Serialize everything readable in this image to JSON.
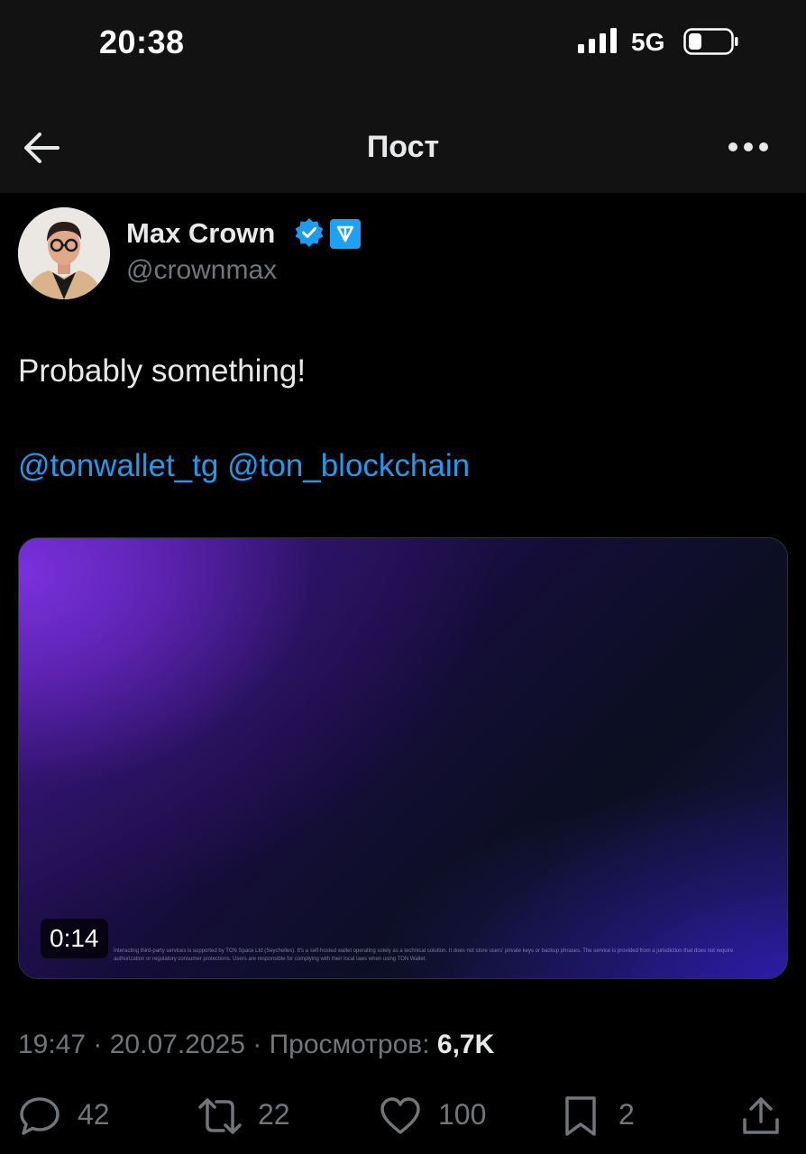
{
  "status_bar": {
    "time": "20:38",
    "network": "5G",
    "icons": [
      "signal-bars-icon",
      "battery-icon"
    ]
  },
  "nav": {
    "title": "Пост",
    "back_icon": "arrow-left-icon",
    "more_icon": "more-horizontal-icon"
  },
  "author": {
    "name": "Max Crown",
    "handle": "@crownmax",
    "badges": [
      "verified-icon",
      "ton-badge-icon"
    ]
  },
  "post": {
    "text": "Probably something!",
    "mentions": [
      "@tonwallet_tg",
      "@ton_blockchain"
    ],
    "video": {
      "duration": "0:14",
      "fine_print": "Interacting third-party services is supported by TON Space Ltd (Seychelles). It's a self-hosted wallet operating solely as a technical solution. It does not store users' private keys or backup phrases. The service is provided from a jurisdiction that does not require authorization or regulatory consumer protections. Users are responsible for complying with their local laws when using TON Wallet."
    },
    "time": "19:47",
    "date": "20.07.2025",
    "views_label": "Просмотров:",
    "views": "6,7K"
  },
  "actions": {
    "replies": "42",
    "reposts": "22",
    "likes": "100",
    "bookmarks": "2"
  },
  "colors": {
    "link": "#1d9bf0",
    "muted": "#71767b",
    "text": "#e7e9ea",
    "background": "#000000"
  }
}
